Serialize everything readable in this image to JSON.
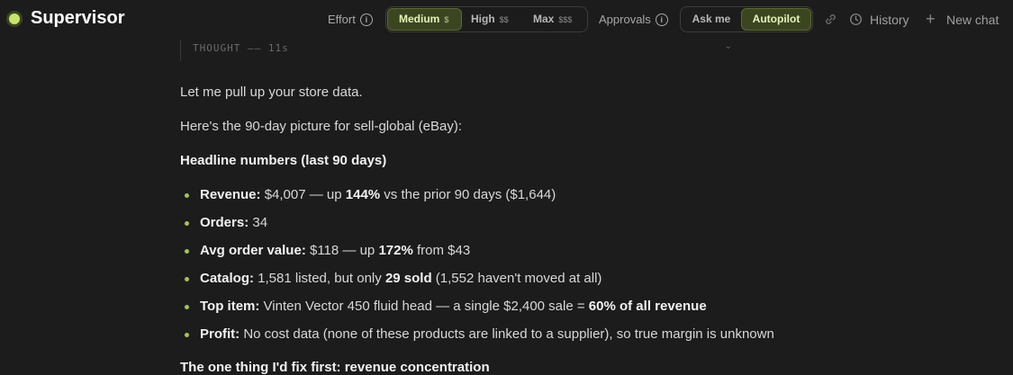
{
  "app": {
    "title": "Supervisor"
  },
  "toolbar": {
    "effort_label": "Effort",
    "effort_options": [
      {
        "label": "Medium",
        "cost": "$",
        "active": true
      },
      {
        "label": "High",
        "cost": "$$",
        "active": false
      },
      {
        "label": "Max",
        "cost": "$$$",
        "active": false
      }
    ],
    "approvals_label": "Approvals",
    "approvals_options": [
      {
        "label": "Ask me",
        "active": false
      },
      {
        "label": "Autopilot",
        "active": true
      }
    ],
    "history_label": "History",
    "new_chat_label": "New chat"
  },
  "thought": {
    "label": "THOUGHT",
    "sep": "——",
    "duration": "11s"
  },
  "message": {
    "intro": "Let me pull up your store data.",
    "summary": "Here's the 90-day picture for sell-global (eBay):",
    "heading": "Headline numbers (last 90 days)",
    "bullets": [
      {
        "key": "Revenue:",
        "parts": [
          " $4,007 — up ",
          {
            "b": "144%"
          },
          " vs the prior 90 days ($1,644)"
        ]
      },
      {
        "key": "Orders:",
        "parts": [
          " 34"
        ]
      },
      {
        "key": "Avg order value:",
        "parts": [
          " $118 — up ",
          {
            "b": "172%"
          },
          " from $43"
        ]
      },
      {
        "key": "Catalog:",
        "parts": [
          " 1,581 listed, but only ",
          {
            "b": "29 sold"
          },
          " (1,552 haven't moved at all)"
        ]
      },
      {
        "key": "Top item:",
        "parts": [
          " Vinten Vector 450 fluid head — a single $2,400 sale = ",
          {
            "b": "60% of all revenue"
          }
        ]
      },
      {
        "key": "Profit:",
        "parts": [
          " No cost data (none of these products are linked to a supplier), so true margin is unknown"
        ]
      }
    ],
    "next_heading": "The one thing I'd fix first: revenue concentration"
  },
  "colors": {
    "accent": "#c7e46a",
    "active_bg": "#3b4621",
    "background": "#1c1c1c"
  }
}
